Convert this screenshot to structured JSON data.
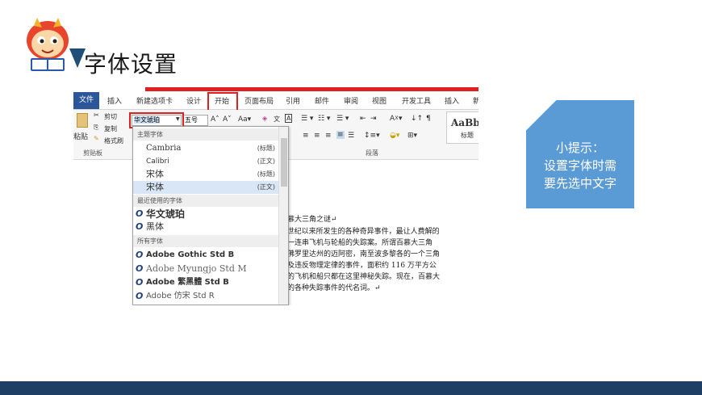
{
  "slide": {
    "title": "字体设置",
    "hint_lines": [
      "小提示：",
      "设置字体时需",
      "要先选中文字"
    ]
  },
  "word": {
    "tabs": [
      "文件",
      "插入",
      "新建选项卡",
      "设计",
      "开始",
      "页面布局",
      "引用",
      "邮件",
      "审阅",
      "视图",
      "开发工具",
      "插入",
      "新"
    ],
    "clipboard": {
      "paste": "粘贴",
      "cut": "剪切",
      "copy": "复制",
      "format_painter": "格式刷",
      "group": "剪贴板"
    },
    "font_name": "华文琥珀",
    "font_size": "五号",
    "paragraph_group": "段落",
    "style_preview": "AaBb",
    "style_label": "标题"
  },
  "dropdown": {
    "theme_header": "主题字体",
    "theme_fonts": [
      {
        "name": "Cambria",
        "tag": "(标题)"
      },
      {
        "name": "Calibri",
        "tag": "(正文)"
      },
      {
        "name": "宋体",
        "tag": "(标题)"
      },
      {
        "name": "宋体",
        "tag": "(正文)"
      }
    ],
    "recent_header": "最近使用的字体",
    "recent_fonts": [
      "华文琥珀",
      "黑体"
    ],
    "all_header": "所有字体",
    "all_fonts": [
      "Adobe Gothic Std B",
      "Adobe Myungjo Std M",
      "Adobe 繁黑體 Std B",
      "Adobe 仿宋 Std R"
    ]
  },
  "document": {
    "lines": [
      "百慕大三角之谜↵",
      "0 世纪以来所发生的各种奇异事件，最让人费解的",
      "的一连串飞机与轮船的失踪案。所谓百慕大三角",
      "由佛罗里达州的迈阿密，南至波多黎各的一个三角",
      "象及违反物理定律的事件，面积约 116 万平方公",
      "中的飞机和船只都在这里神秘失踪。现在，百慕大",
      "种的各种失踪事件的代名词。↵"
    ]
  },
  "colors": {
    "accent": "#2b579a",
    "highlight": "#e02020",
    "hint_bg": "#5b9bd5",
    "footer": "#1f3e63"
  }
}
